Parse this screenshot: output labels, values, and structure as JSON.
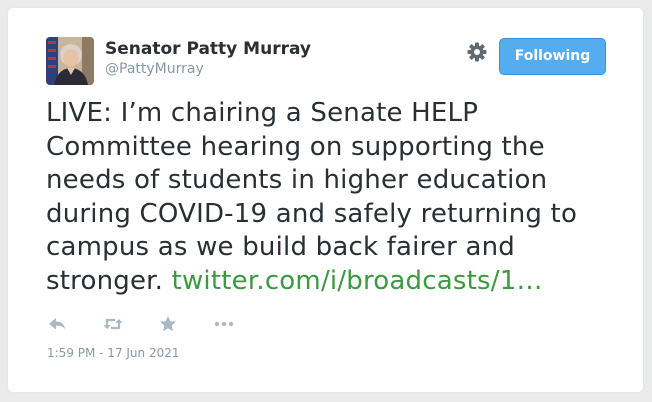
{
  "user": {
    "display_name": "Senator Patty Murray",
    "handle": "@PattyMurray"
  },
  "follow_button": {
    "label": "Following"
  },
  "tweet": {
    "text_before_link": "LIVE: I’m chairing a Senate HELP Committee hearing on supporting the needs of students in higher education during COVID-19 and safely returning to campus as we build back fairer and stronger. ",
    "link_text": "twitter.com/i/broadcasts/1…",
    "timestamp": "1:59 PM - 17 Jun 2021"
  },
  "icons": {
    "settings": "gear-icon",
    "reply": "reply-icon",
    "retweet": "retweet-icon",
    "favorite": "star-icon",
    "more": "more-icon"
  },
  "colors": {
    "follow_button_bg": "#55acee",
    "link": "#3b9a3f",
    "text": "#292f33",
    "muted": "#8899a6"
  }
}
